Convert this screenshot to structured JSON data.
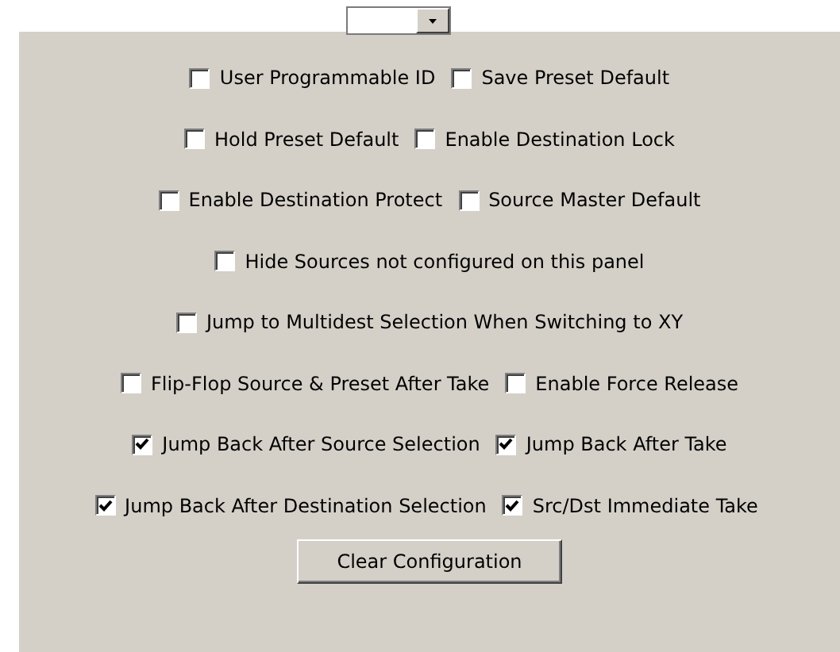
{
  "rows": [
    {
      "options": [
        {
          "label": "User Programmable ID",
          "checked": false
        },
        {
          "label": "Save Preset Default",
          "checked": false
        }
      ]
    },
    {
      "options": [
        {
          "label": "Hold Preset Default",
          "checked": false
        },
        {
          "label": "Enable Destination Lock",
          "checked": false
        }
      ]
    },
    {
      "options": [
        {
          "label": "Enable Destination Protect",
          "checked": false
        },
        {
          "label": "Source Master Default",
          "checked": false
        }
      ]
    },
    {
      "options": [
        {
          "label": "Hide Sources not configured on this panel",
          "checked": false
        }
      ]
    },
    {
      "options": [
        {
          "label": "Jump to Multidest Selection When Switching to XY",
          "checked": false
        }
      ]
    },
    {
      "options": [
        {
          "label": "Flip-Flop Source & Preset After Take",
          "checked": false
        },
        {
          "label": "Enable Force Release",
          "checked": false
        }
      ]
    },
    {
      "options": [
        {
          "label": "Jump Back After Source Selection",
          "checked": true
        },
        {
          "label": "Jump Back After Take",
          "checked": true
        }
      ]
    },
    {
      "options": [
        {
          "label": "Jump Back After Destination Selection",
          "checked": true
        },
        {
          "label": "Src/Dst Immediate Take",
          "checked": true
        }
      ]
    }
  ],
  "button": "Clear Configuration"
}
